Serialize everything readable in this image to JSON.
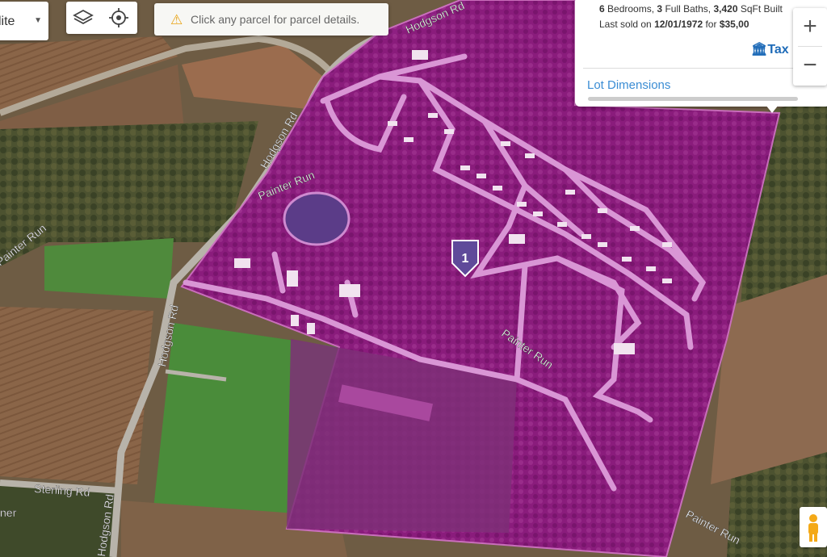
{
  "basemap": {
    "selected": "lite"
  },
  "hint": {
    "text": "Click any parcel for parcel details."
  },
  "popup": {
    "bedrooms": "6",
    "bedrooms_label": "Bedrooms,",
    "baths": "3",
    "baths_label": "Full Baths,",
    "sqft": "3,420",
    "sqft_label": "SqFt",
    "built_label": "Built",
    "sold_prefix": "Last sold on",
    "sold_date": "12/01/1972",
    "sold_for": "for",
    "sold_price": "$35,00",
    "tax_label": "Tax",
    "lot_dimensions": "Lot Dimensions"
  },
  "zoom": {
    "in": "+",
    "out": "−"
  },
  "map": {
    "roads": {
      "hodgson_top": "Hodgson Rd",
      "hodgson_mid": "Hodgson Rd",
      "hodgson_low": "Hodgson Rd",
      "hodgson_bottom": "Hodgson Rd",
      "painter_run_left": "Painter Run",
      "painter_run_inside": "Painter Run",
      "painter_run_parcel": "Painter Run",
      "painter_run_bottom": "Painter Run",
      "sterling": "Sterling Rd",
      "edge_fragment": "ner"
    },
    "marker": {
      "label": "1"
    },
    "colors": {
      "parcel": "#a4168f",
      "road_in_parcel": "#d996d5",
      "marker": "#5f4a9a"
    }
  }
}
